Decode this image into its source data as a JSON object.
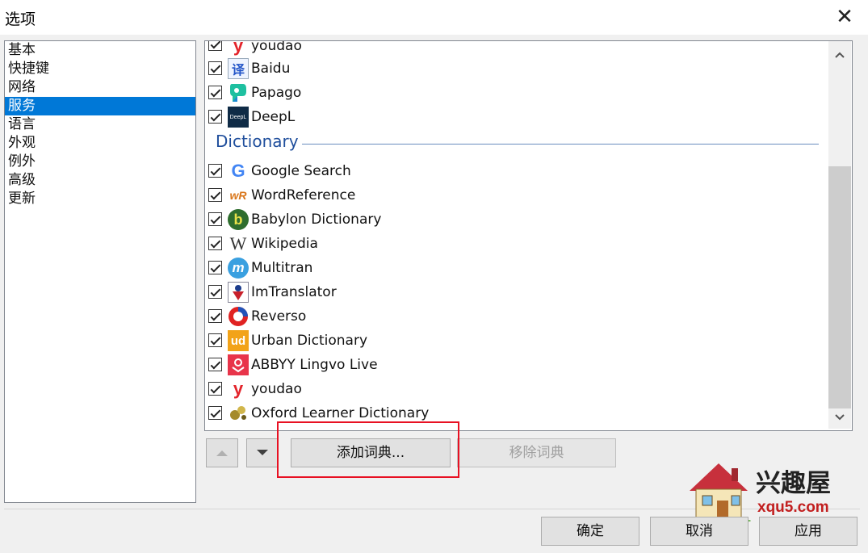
{
  "window": {
    "title": "选项"
  },
  "nav": {
    "items": [
      {
        "label": "基本"
      },
      {
        "label": "快捷键"
      },
      {
        "label": "网络"
      },
      {
        "label": "服务",
        "selected": true
      },
      {
        "label": "语言"
      },
      {
        "label": "外观"
      },
      {
        "label": "例外"
      },
      {
        "label": "高级"
      },
      {
        "label": "更新"
      }
    ]
  },
  "translators": [
    {
      "label": "youdao",
      "icon": "youdao-icon",
      "checked": true
    },
    {
      "label": "Baidu",
      "icon": "baidu-icon",
      "checked": true
    },
    {
      "label": "Papago",
      "icon": "papago-icon",
      "checked": true
    },
    {
      "label": "DeepL",
      "icon": "deepl-icon",
      "checked": true
    }
  ],
  "dictionary_section": {
    "title": "Dictionary",
    "items": [
      {
        "label": "Google Search",
        "icon": "google-icon",
        "checked": true
      },
      {
        "label": "WordReference",
        "icon": "wordreference-icon",
        "checked": true
      },
      {
        "label": "Babylon Dictionary",
        "icon": "babylon-icon",
        "checked": true
      },
      {
        "label": "Wikipedia",
        "icon": "wikipedia-icon",
        "checked": true
      },
      {
        "label": "Multitran",
        "icon": "multitran-icon",
        "checked": true
      },
      {
        "label": "ImTranslator",
        "icon": "imtranslator-icon",
        "checked": true
      },
      {
        "label": "Reverso",
        "icon": "reverso-icon",
        "checked": true
      },
      {
        "label": "Urban Dictionary",
        "icon": "urban-dictionary-icon",
        "checked": true
      },
      {
        "label": "ABBYY Lingvo Live",
        "icon": "abbyy-icon",
        "checked": true
      },
      {
        "label": "youdao",
        "icon": "youdao-icon",
        "checked": true
      },
      {
        "label": "Oxford Learner Dictionary",
        "icon": "oxford-icon",
        "checked": true
      }
    ]
  },
  "icon_text": {
    "youdao": "y",
    "baidu": "译",
    "deepl": "DeepL",
    "google": "G",
    "wordreference": "wR",
    "babylon": "b",
    "wikipedia": "W",
    "multitran": "m",
    "urban": "ud"
  },
  "buttons": {
    "add_dictionary": "添加词典...",
    "remove_dictionary": "移除词典",
    "ok": "确定",
    "cancel": "取消",
    "apply": "应用"
  },
  "watermark": {
    "name": "兴趣屋",
    "url": "xqu5.com"
  },
  "colors": {
    "selection": "#0078d7",
    "section_title": "#1f4e9c",
    "highlight_box": "#e81123"
  }
}
